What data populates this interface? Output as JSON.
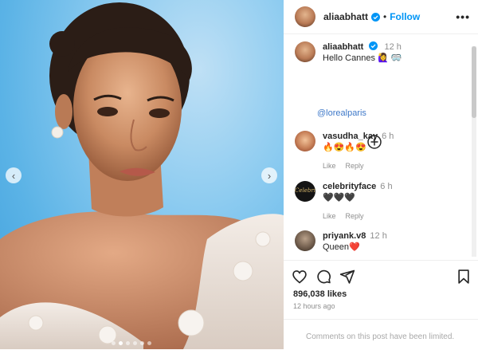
{
  "post": {
    "username": "aliaabhatt",
    "follow_label": "Follow",
    "dot": "•",
    "more_glyph": "•••"
  },
  "photo": {
    "prev_glyph": "‹",
    "next_glyph": "›",
    "slide_count": 6,
    "active_slide": 1
  },
  "caption": {
    "username": "aliaabhatt",
    "time": "12 h",
    "text": "Hello Cannes 🙋‍♀️ 🥽",
    "mention": "@lorealparis"
  },
  "comments": [
    {
      "username": "vasudha_kay",
      "time": "6 h",
      "text": "🔥😍🔥😍",
      "like": "Like",
      "reply": "Reply"
    },
    {
      "username": "celebrityface",
      "time": "6 h",
      "text": "🖤🖤🖤",
      "like": "Like",
      "reply": "Reply",
      "avatar_text": "Celebrity"
    },
    {
      "username": "priyank.v8",
      "time": "12 h",
      "text": "Queen❤️"
    }
  ],
  "stats": {
    "likes": "896,038 likes",
    "posted": "12 hours ago"
  },
  "footer": {
    "limited_text": "Comments on this post have been limited."
  },
  "colors": {
    "accent": "#0095f6",
    "verified": "#0095f6",
    "mention": "#3f79c9",
    "sky": "#5bb3e6"
  }
}
